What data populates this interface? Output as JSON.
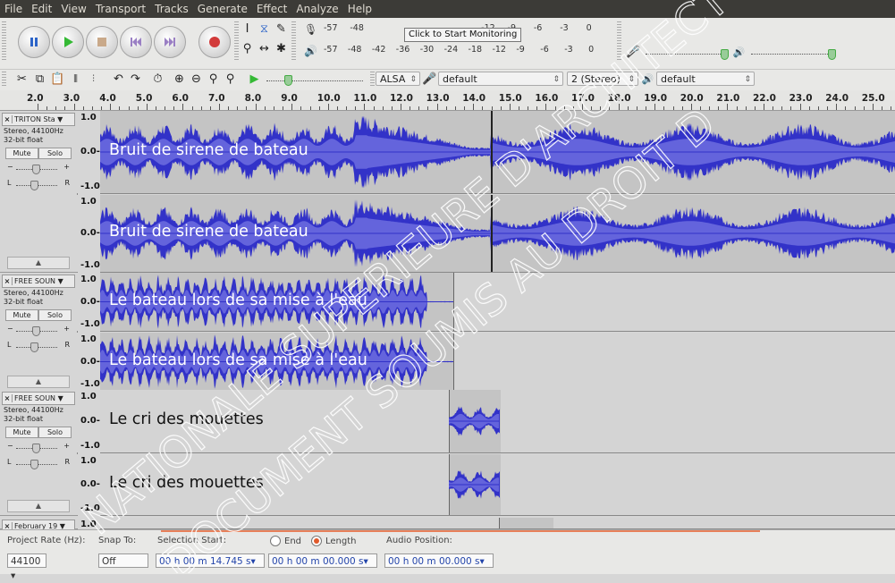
{
  "menu": [
    "File",
    "Edit",
    "View",
    "Transport",
    "Tracks",
    "Generate",
    "Effect",
    "Analyze",
    "Help"
  ],
  "transport": [
    "pause-icon",
    "play-icon",
    "stop-icon",
    "skip-start-icon",
    "skip-end-icon",
    "record-icon"
  ],
  "meters": {
    "record_scale": [
      "-57",
      "-48",
      "",
      "",
      "",
      "",
      "-12",
      "-9",
      "-6",
      "-3",
      "0"
    ],
    "monitor_label": "Click to Start Monitoring",
    "monitor_tail": "8",
    "play_scale": [
      "-57",
      "-48",
      "-42",
      "-36",
      "-30",
      "-24",
      "-18",
      "-12",
      "-9",
      "-6",
      "-3",
      "0"
    ]
  },
  "device": {
    "host": "ALSA",
    "rec_device": "default",
    "channels": "2 (Stereo)",
    "play_device": "default"
  },
  "ruler": [
    "2.0",
    "3.0",
    "4.0",
    "5.0",
    "6.0",
    "7.0",
    "8.0",
    "9.0",
    "10.0",
    "11.0",
    "12.0",
    "13.0",
    "14.0",
    "15.0",
    "16.0",
    "17.0",
    "18.0",
    "19.0",
    "20.0",
    "21.0",
    "22.0",
    "23.0",
    "24.0",
    "25.0"
  ],
  "tracks": [
    {
      "name": "TRITON Sta",
      "info1": "Stereo, 44100Hz",
      "info2": "32-bit float",
      "mute": "Mute",
      "solo": "Solo",
      "channel_labels": [
        "Bruit de sirene de bateau",
        "Bruit de sirene de bateau"
      ],
      "scale": [
        "1.0",
        "0.0-",
        "-1.0"
      ]
    },
    {
      "name": "FREE SOUN",
      "info1": "Stereo, 44100Hz",
      "info2": "32-bit float",
      "mute": "Mute",
      "solo": "Solo",
      "channel_labels": [
        "Le bateau lors de sa mise à l'eau",
        "Le bateau lors de sa mise à l'eau"
      ],
      "scale": [
        "1.0",
        "0.0-",
        "-1.0"
      ]
    },
    {
      "name": "FREE SOUN",
      "info1": "Stereo, 44100Hz",
      "info2": "32-bit float",
      "mute": "Mute",
      "solo": "Solo",
      "channel_labels": [
        "Le cri des mouettes",
        "Le cri des mouettes"
      ],
      "scale": [
        "1.0",
        "0.0-",
        "-1.0"
      ]
    },
    {
      "name": "February 19",
      "scale": [
        "1.0"
      ]
    }
  ],
  "selection": {
    "rate_label": "Project Rate (Hz):",
    "rate_value": "44100",
    "snap_label": "Snap To:",
    "snap_value": "Off",
    "start_label": "Selection Start:",
    "end_label": "End",
    "length_label": "Length",
    "start_value": "00 h 00 m 14.745 s",
    "length_value": "00 h 00 m 00.000 s",
    "position_label": "Audio Position:",
    "position_value": "00 h 00 m 00.000 s"
  },
  "watermark": [
    "NATIONALE SUPERIEURE D'ARCHITECTURE",
    "DOCUMENT SOUMIS AU DROIT D"
  ]
}
